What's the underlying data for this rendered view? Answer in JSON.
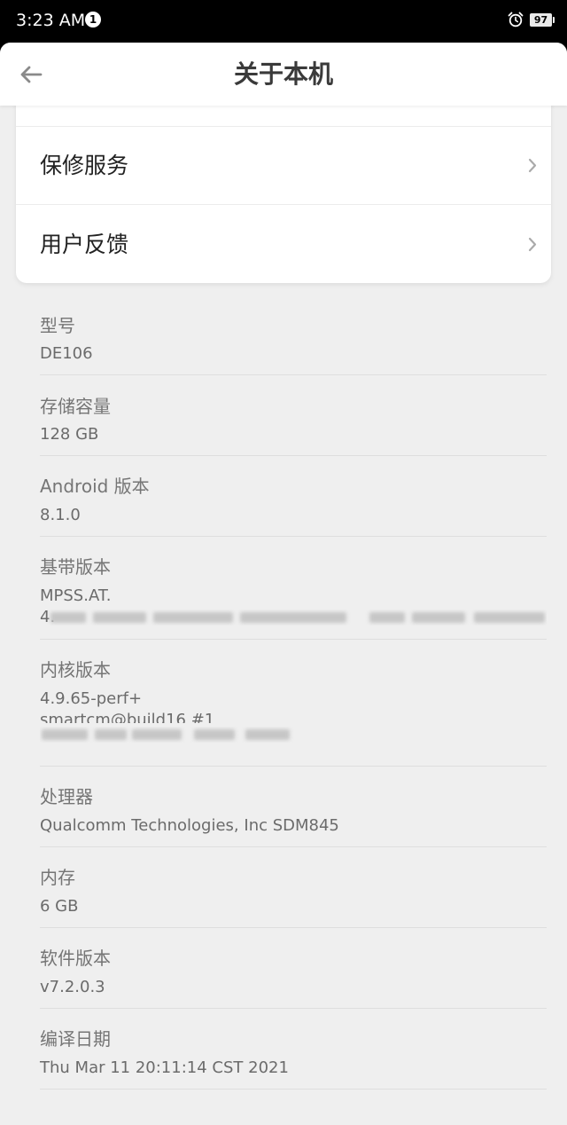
{
  "status_bar": {
    "time": "3:23 AM",
    "notification_count": "1",
    "alarm_icon": "alarm-clock-icon",
    "battery": "97"
  },
  "header": {
    "back_icon": "arrow-left-icon",
    "title": "关于本机"
  },
  "menu": {
    "items": [
      {
        "label": "保修服务",
        "icon": "chevron-right-icon"
      },
      {
        "label": "用户反馈",
        "icon": "chevron-right-icon"
      }
    ]
  },
  "info": {
    "model": {
      "label": "型号",
      "value": "DE106"
    },
    "storage": {
      "label": "存储容量",
      "value": "128 GB"
    },
    "android": {
      "label": "Android 版本",
      "value": "8.1.0"
    },
    "baseband": {
      "label": "基带版本",
      "value": "MPSS.AT.",
      "value_line2": "4."
    },
    "kernel": {
      "label": "内核版本",
      "value": "4.9.65-perf+",
      "value_line2": "smartcm@build16 #1"
    },
    "processor": {
      "label": "处理器",
      "value": "Qualcomm Technologies, Inc SDM845"
    },
    "memory": {
      "label": "内存",
      "value": "6 GB"
    },
    "software": {
      "label": "软件版本",
      "value": "v7.2.0.3"
    },
    "build_date": {
      "label": "编译日期",
      "value": "Thu Mar 11 20:11:14 CST 2021"
    }
  },
  "colors": {
    "background": "#efefef",
    "card": "#ffffff",
    "label_text": "#757575",
    "value_text": "#6b6b6b",
    "title_text": "#3a3a3a"
  }
}
